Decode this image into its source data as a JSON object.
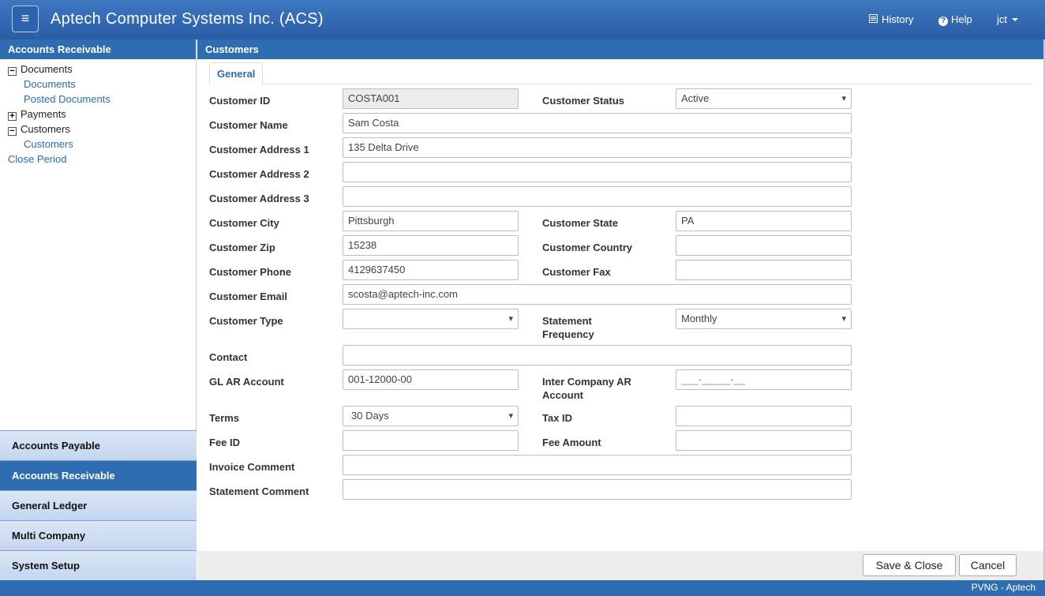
{
  "header": {
    "menu_glyph": "≡",
    "title": "Aptech Computer Systems Inc. (ACS)",
    "history_label": "History",
    "help_label": "Help",
    "user_label": "jct"
  },
  "sidebar": {
    "title": "Accounts Receivable",
    "tree": [
      {
        "label": "Documents",
        "toggle": "−"
      },
      {
        "label": "Documents"
      },
      {
        "label": "Posted Documents"
      },
      {
        "label": "Payments",
        "toggle": "+"
      },
      {
        "label": "Customers",
        "toggle": "−"
      },
      {
        "label": "Customers"
      },
      {
        "label": "Close Period"
      }
    ],
    "modules": [
      "Accounts Payable",
      "Accounts Receivable",
      "General Ledger",
      "Multi Company",
      "System Setup"
    ]
  },
  "main": {
    "title": "Customers",
    "tab": "General"
  },
  "form": {
    "customer_id": {
      "label": "Customer ID",
      "value": "COSTA001"
    },
    "customer_status": {
      "label": "Customer Status",
      "value": "Active"
    },
    "customer_name": {
      "label": "Customer Name",
      "value": "Sam Costa"
    },
    "address1": {
      "label": "Customer Address 1",
      "value": "135 Delta Drive"
    },
    "address2": {
      "label": "Customer Address 2",
      "value": ""
    },
    "address3": {
      "label": "Customer Address 3",
      "value": ""
    },
    "city": {
      "label": "Customer City",
      "value": "Pittsburgh"
    },
    "state": {
      "label": "Customer State",
      "value": "PA"
    },
    "zip": {
      "label": "Customer Zip",
      "value": "15238"
    },
    "country": {
      "label": "Customer Country",
      "value": ""
    },
    "phone": {
      "label": "Customer Phone",
      "value": "4129637450"
    },
    "fax": {
      "label": "Customer Fax",
      "value": ""
    },
    "email": {
      "label": "Customer Email",
      "value": "scosta@aptech-inc.com"
    },
    "type": {
      "label": "Customer Type",
      "value": ""
    },
    "statement_frequency": {
      "label": "Statement Frequency",
      "value": "Monthly"
    },
    "contact": {
      "label": "Contact",
      "value": ""
    },
    "gl_ar_account": {
      "label": "GL AR Account",
      "value": "001-12000-00"
    },
    "ic_ar_account": {
      "label": "Inter Company AR Account",
      "value": "___-_____-__"
    },
    "terms": {
      "label": "Terms",
      "value": "30 Days"
    },
    "tax_id": {
      "label": "Tax ID",
      "value": ""
    },
    "fee_id": {
      "label": "Fee ID",
      "value": ""
    },
    "fee_amount": {
      "label": "Fee Amount",
      "value": ""
    },
    "invoice_comment": {
      "label": "Invoice Comment",
      "value": ""
    },
    "statement_comment": {
      "label": "Statement Comment",
      "value": ""
    }
  },
  "actions": {
    "save_close": "Save & Close",
    "cancel": "Cancel"
  },
  "status": {
    "text": "PVNG - Aptech"
  }
}
